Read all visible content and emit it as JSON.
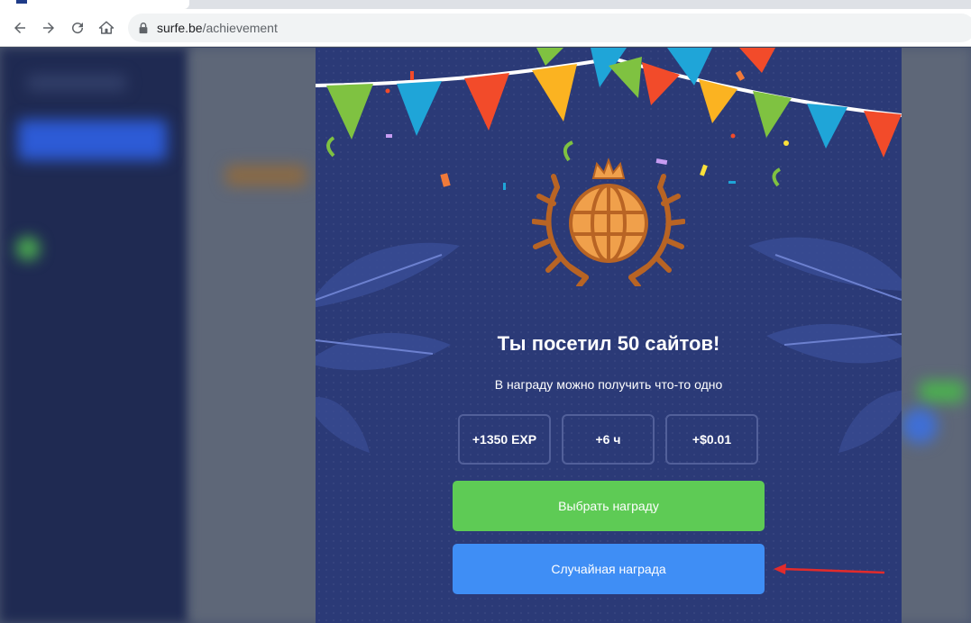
{
  "browser": {
    "url_host": "surfe.be",
    "url_path": "/achievement"
  },
  "modal": {
    "title": "Ты посетил 50 сайтов!",
    "subtitle": "В награду можно получить что-то одно",
    "rewards": [
      {
        "label": "+1350 EXP"
      },
      {
        "label": "+6 ч"
      },
      {
        "label": "+$0.01"
      }
    ],
    "choose_button": "Выбрать награду",
    "random_button": "Случайная награда"
  },
  "colors": {
    "modal_bg": "#2b3a77",
    "choose_button": "#5ecb55",
    "random_button": "#3f8ef5",
    "trophy": "#f0a04b",
    "annotation_arrow": "#e32b2b"
  },
  "icons": [
    "back-arrow-icon",
    "forward-arrow-icon",
    "reload-icon",
    "home-icon",
    "lock-icon",
    "trophy-globe-icon",
    "laurel-icon",
    "crown-icon"
  ]
}
